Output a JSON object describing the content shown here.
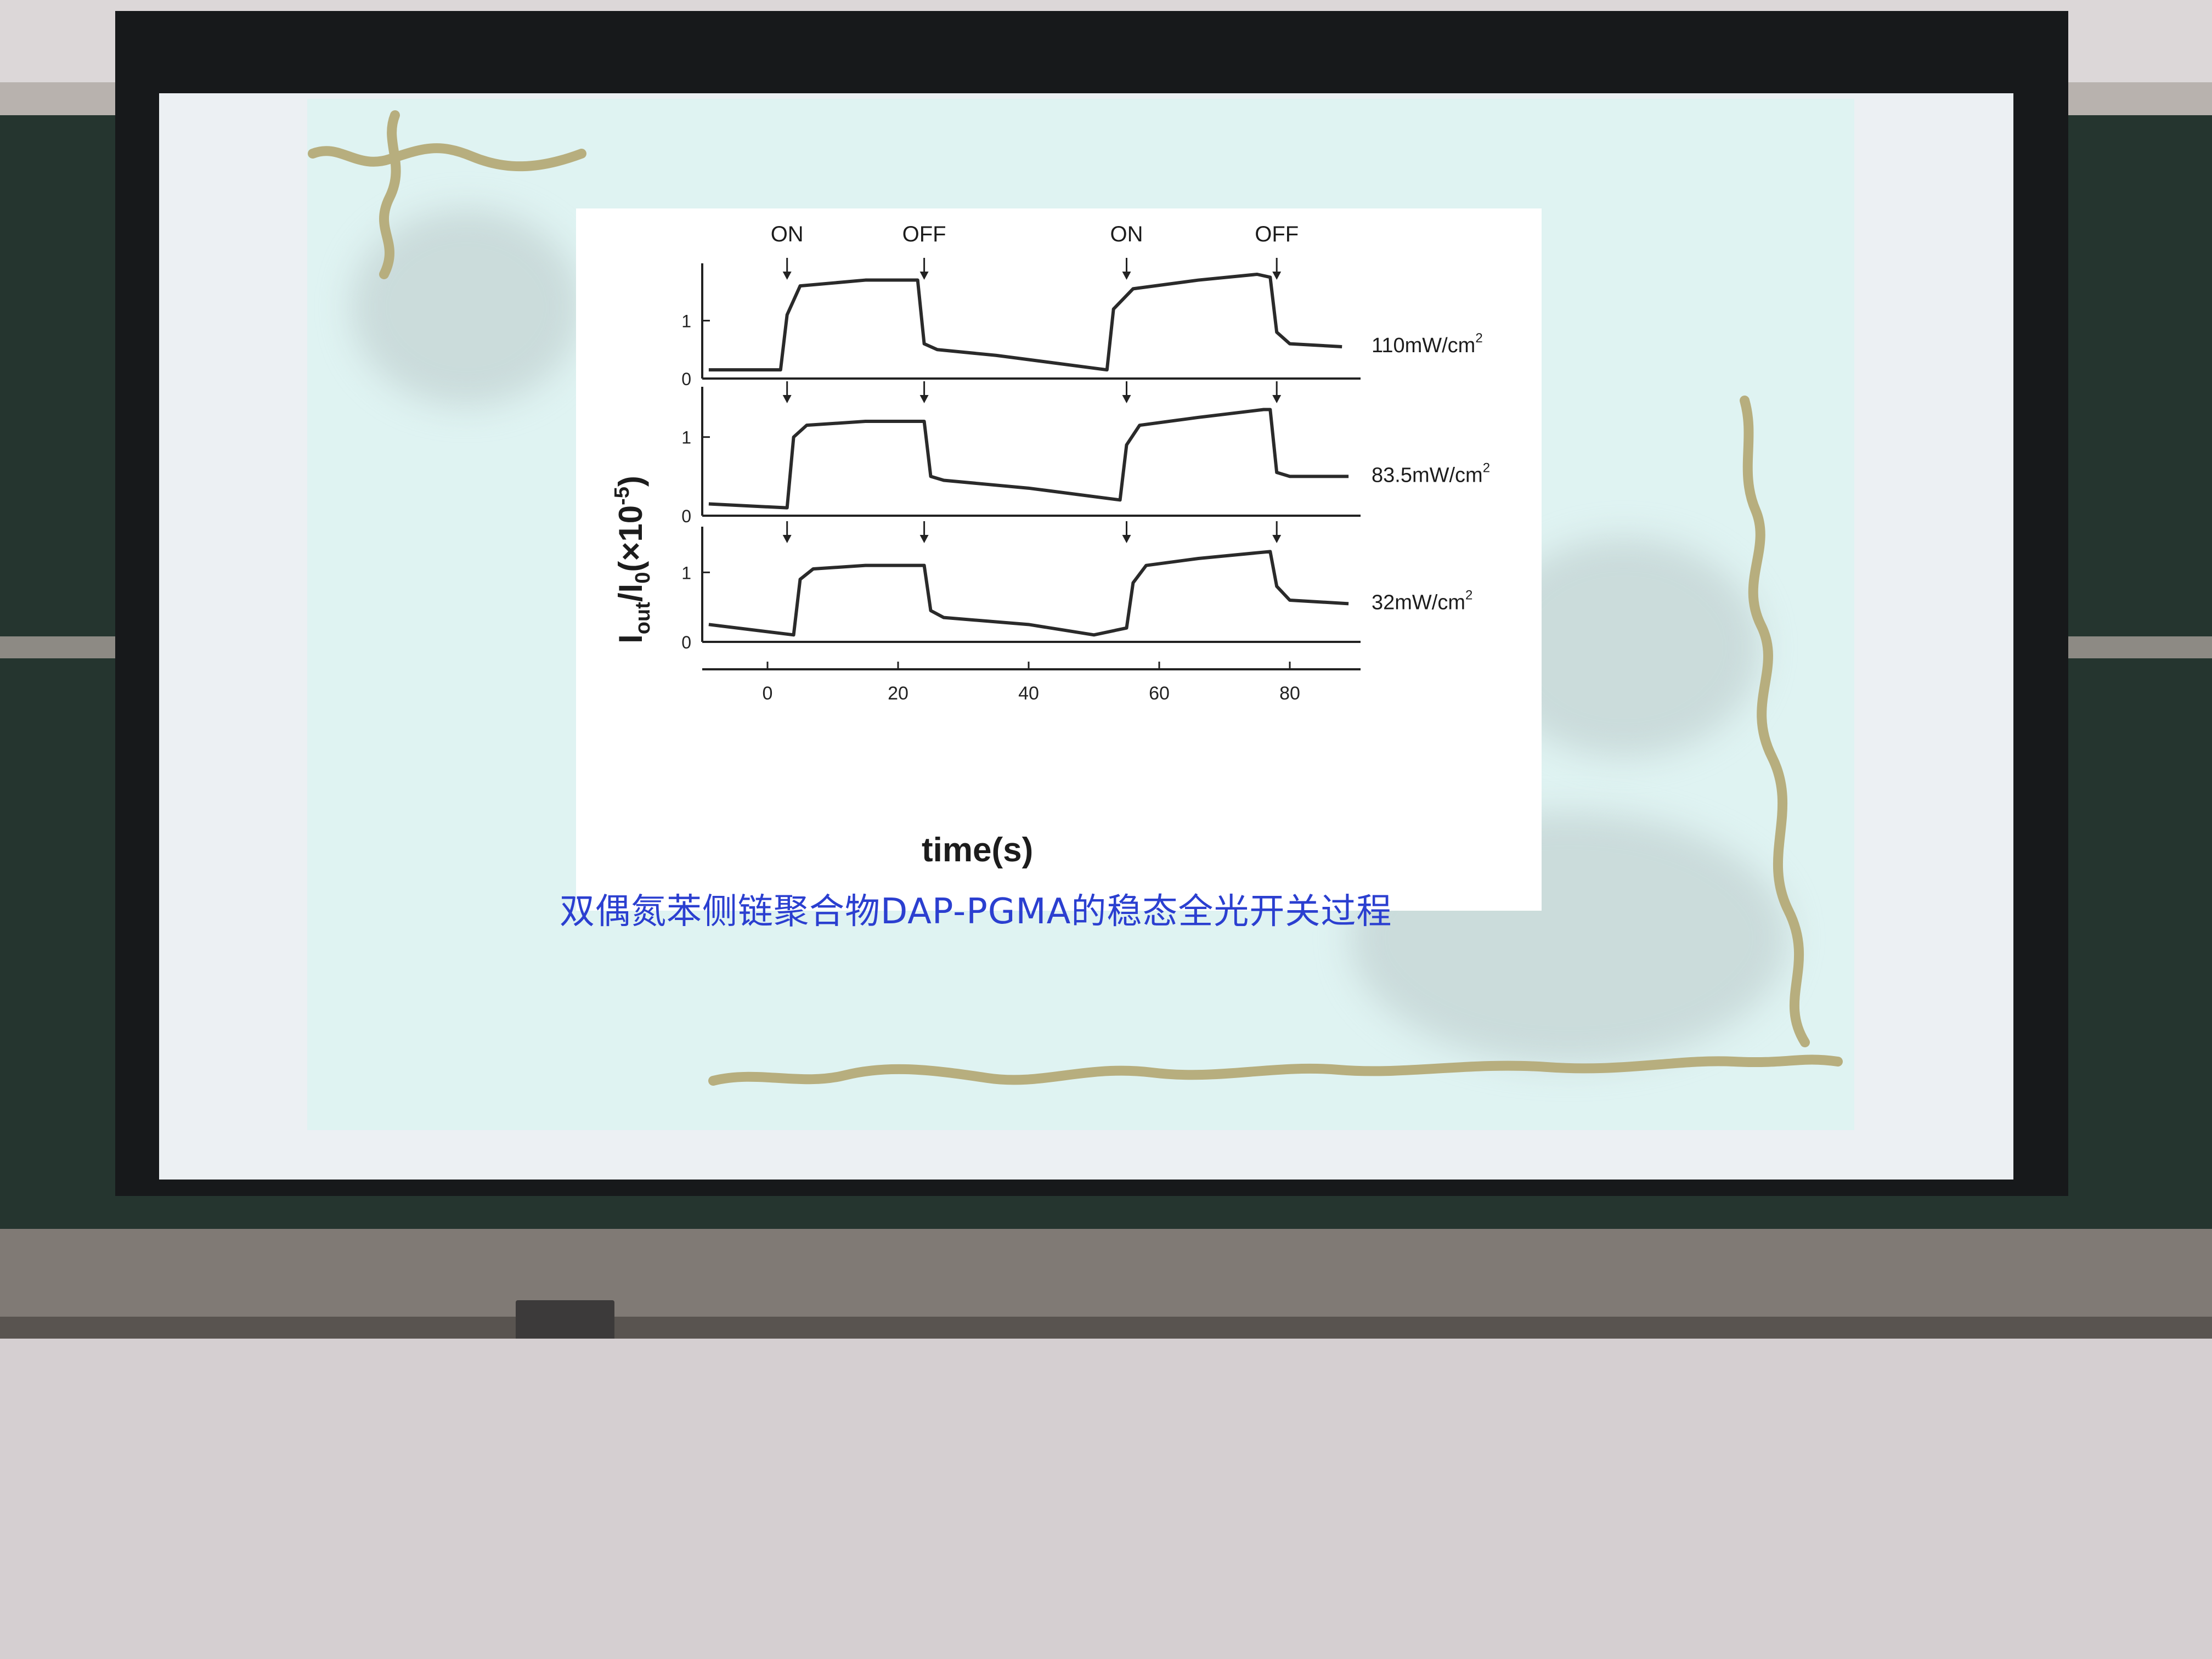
{
  "slide": {
    "caption": "双偶氮苯侧链聚合物DAP-PGMA的稳态全光开关过程"
  },
  "chart_data": {
    "type": "line",
    "title": "",
    "xlabel": "time(s)",
    "ylabel": "I_out/I_0(×10^-5)",
    "ylabel_parts": {
      "main": "I",
      "sub_out": "out",
      "slash": "/I",
      "sub_zero": "0",
      "mult": "(×10",
      "exp": "-5",
      "close": ")"
    },
    "xlim": [
      -10,
      90
    ],
    "xticks": [
      "0",
      "20",
      "40",
      "60",
      "80"
    ],
    "xtick_values": [
      0,
      20,
      40,
      60,
      80
    ],
    "grid": false,
    "annotations": {
      "on1": "ON",
      "off1": "OFF",
      "on2": "ON",
      "off2": "OFF",
      "on_times": [
        3,
        55
      ],
      "off_times": [
        24,
        78
      ]
    },
    "panels": [
      {
        "name": "110mW/cm²",
        "label_main": "110mW/cm",
        "label_sup": "2",
        "ylim": [
          0,
          1.8
        ],
        "yticks": [
          "0",
          "1"
        ],
        "x": [
          -9,
          2,
          3,
          5,
          15,
          23,
          24,
          26,
          35,
          52,
          53,
          56,
          66,
          75,
          77,
          78,
          80,
          88
        ],
        "y": [
          0.15,
          0.15,
          1.1,
          1.6,
          1.7,
          1.7,
          0.6,
          0.5,
          0.4,
          0.15,
          1.2,
          1.55,
          1.7,
          1.8,
          1.75,
          0.8,
          0.6,
          0.55
        ]
      },
      {
        "name": "83.5mW/cm²",
        "label_main": "83.5mW/cm",
        "label_sup": "2",
        "ylim": [
          0,
          1.5
        ],
        "yticks": [
          "0",
          "1"
        ],
        "x": [
          -9,
          3,
          4,
          6,
          15,
          24,
          25,
          27,
          40,
          54,
          55,
          57,
          66,
          76,
          77,
          78,
          80,
          89
        ],
        "y": [
          0.15,
          0.1,
          1.0,
          1.15,
          1.2,
          1.2,
          0.5,
          0.45,
          0.35,
          0.2,
          0.9,
          1.15,
          1.25,
          1.35,
          1.35,
          0.55,
          0.5,
          0.5
        ]
      },
      {
        "name": "32mW/cm²",
        "label_main": "32mW/cm",
        "label_sup": "2",
        "ylim": [
          0,
          1.5
        ],
        "yticks": [
          "0",
          "1"
        ],
        "x": [
          -9,
          4,
          5,
          7,
          15,
          24,
          25,
          27,
          40,
          50,
          55,
          56,
          58,
          66,
          77,
          78,
          80,
          89
        ],
        "y": [
          0.25,
          0.1,
          0.9,
          1.05,
          1.1,
          1.1,
          0.45,
          0.35,
          0.25,
          0.1,
          0.2,
          0.85,
          1.1,
          1.2,
          1.3,
          0.8,
          0.6,
          0.55
        ]
      }
    ]
  }
}
